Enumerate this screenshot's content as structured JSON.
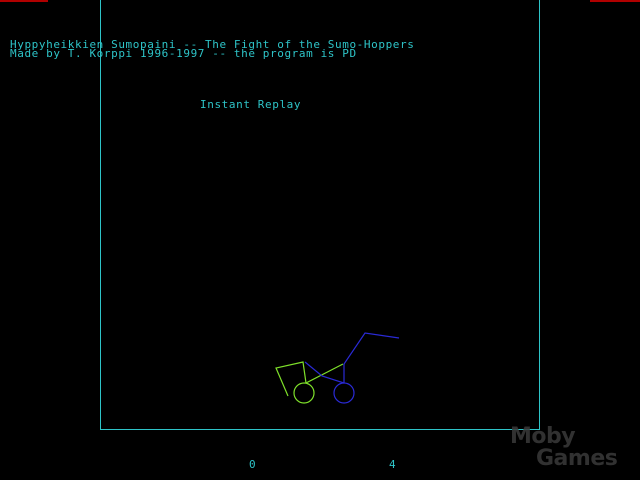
{
  "header": {
    "title": "Hyppyheikkien Sumopaini -- The Fight of the Sumo-Hoppers",
    "credit": "Made by T. Korppi 1996-1997 -- the program is PD"
  },
  "status": {
    "mode_label": "Instant Replay"
  },
  "scores": {
    "left_player": "0",
    "right_player": "4"
  },
  "fighters": {
    "green": {
      "color": "#7ee02a"
    },
    "blue": {
      "color": "#2a2ad6"
    }
  },
  "colors": {
    "text": "#2ec4c8",
    "arena_border": "#2ec4c8",
    "corner_marks": "#b00000",
    "background": "#000000"
  },
  "watermark": {
    "line1": "Moby",
    "line2": "Games"
  }
}
